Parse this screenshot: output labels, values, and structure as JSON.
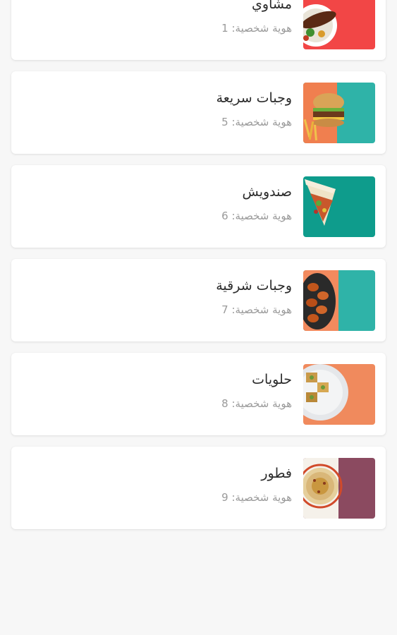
{
  "id_prefix": "هوية شخصية: ",
  "categories": [
    {
      "name": "مشاوي",
      "id_text": "هوية شخصية: 1",
      "icon": "grill-food-icon",
      "bg_color": "#f24646"
    },
    {
      "name": "وجبات سريعة",
      "id_text": "هوية شخصية: 5",
      "icon": "burger-fries-icon",
      "bg_color": "#2fb3a8"
    },
    {
      "name": "صندويش",
      "id_text": "هوية شخصية: 6",
      "icon": "wrap-sandwich-icon",
      "bg_color": "#0e9c8c"
    },
    {
      "name": "وجبات شرقية",
      "id_text": "هوية شخصية: 7",
      "icon": "chicken-wings-icon",
      "bg_color": "#2fb3a8"
    },
    {
      "name": "حلويات",
      "id_text": "هوية شخصية: 8",
      "icon": "baklava-plate-icon",
      "bg_color": "#f08a5d"
    },
    {
      "name": "فطور",
      "id_text": "هوية شخصية: 9",
      "icon": "hummus-plate-icon",
      "bg_color": "#8b4a60"
    }
  ]
}
